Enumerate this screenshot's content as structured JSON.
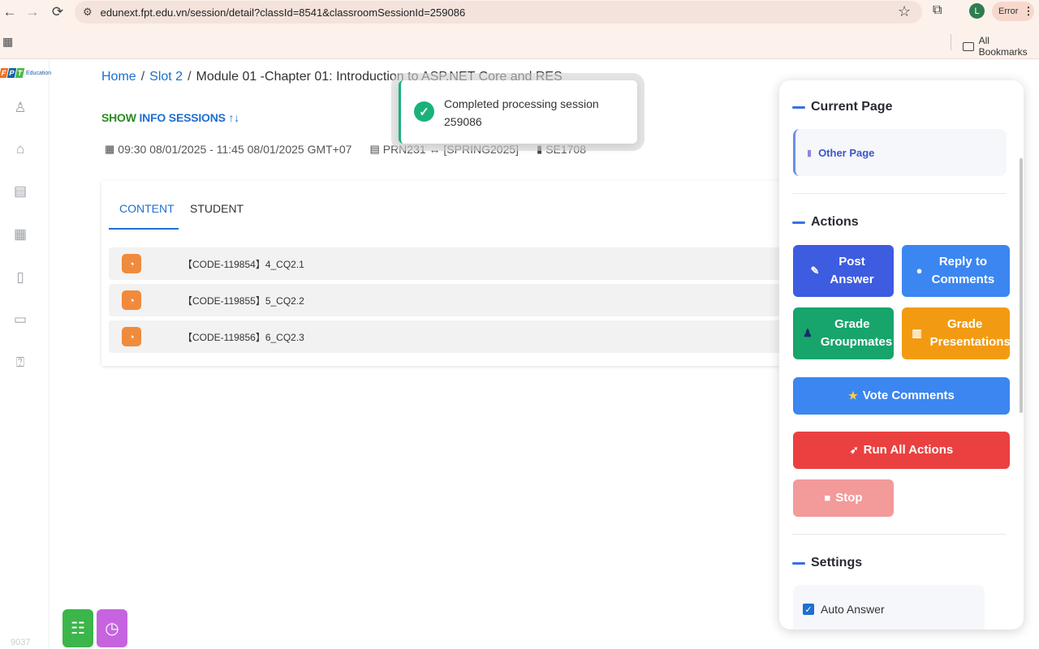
{
  "browser": {
    "url": "edunext.fpt.edu.vn/session/detail?classId=8541&classroomSessionId=259086",
    "profile_initial": "L",
    "error_label": "Error",
    "all_bookmarks": "All Bookmarks"
  },
  "logo": {
    "letters": [
      "F",
      "P",
      "T"
    ],
    "suffix": "Education"
  },
  "rail": {
    "bottom_number": "9037"
  },
  "breadcrumb": {
    "home": "Home",
    "slot": "Slot 2",
    "current": "Module 01 -Chapter 01: Introduction to ASP.NET Core and RES",
    "separator": "/"
  },
  "show_info": {
    "part1": "SHOW",
    "part2": "INFO SESSIONS",
    "arrows": "↑↓"
  },
  "meta": {
    "time": "09:30 08/01/2025 - 11:45 08/01/2025 GMT+07",
    "course": "PRN231 ↔ [SPRING2025]",
    "class": "SE1708"
  },
  "tabs": {
    "content": "CONTENT",
    "student": "STUDENT"
  },
  "questions": [
    {
      "code": "【CODE-119854】4_CQ2.1"
    },
    {
      "code": "【CODE-119855】5_CQ2.2"
    },
    {
      "code": "【CODE-119856】6_CQ2.3"
    }
  ],
  "toast": {
    "message": "Completed processing session 259086"
  },
  "panel": {
    "current_page_title": "Current Page",
    "current_page_value": "Other Page",
    "actions_title": "Actions",
    "actions": {
      "post_answer": "Post Answer",
      "reply_comments": "Reply to Comments",
      "grade_groupmates": "Grade Groupmates",
      "grade_presentations": "Grade Presentations",
      "vote_comments": "Vote Comments",
      "run_all": "Run All Actions",
      "stop": "Stop"
    },
    "settings_title": "Settings",
    "settings": {
      "auto_answer": "Auto Answer",
      "auto_answer_checked": true
    }
  },
  "colors": {
    "accent_blue": "#1f6fd0",
    "post_answer": "#3d5ce0",
    "reply": "#3b86f1",
    "groupmates": "#17a56c",
    "presentations": "#f29b12",
    "run_all": "#ea4040",
    "stop": "#f39a9a",
    "toast_success": "#1bb27a",
    "question_badge": "#f08a3c"
  }
}
